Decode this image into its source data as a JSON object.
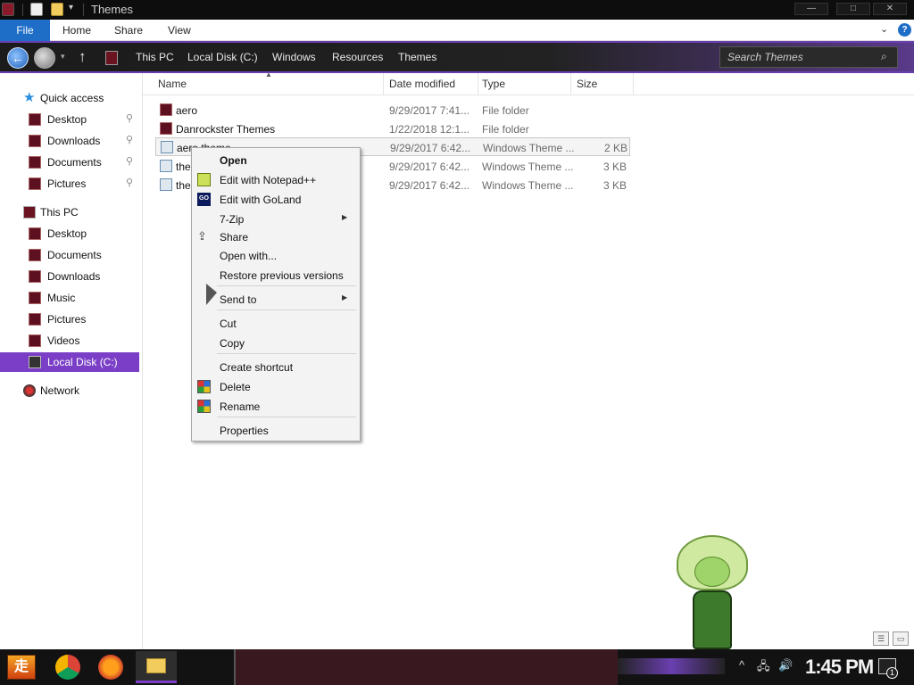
{
  "window": {
    "title": "Themes",
    "minimize_glyph": "—",
    "maximize_glyph": "□",
    "close_glyph": "✕"
  },
  "ribbon": {
    "tabs": [
      "File",
      "Home",
      "Share",
      "View"
    ],
    "help_glyph": "?",
    "expand_glyph": "⌄"
  },
  "address": {
    "back_glyph": "←",
    "up_glyph": "↑",
    "breadcrumbs": [
      "This PC",
      "Local Disk (C:)",
      "Windows",
      "Resources",
      "Themes"
    ],
    "search_placeholder": "Search Themes"
  },
  "sidebar": {
    "quick_access": "Quick access",
    "quick_items": [
      {
        "label": "Desktop",
        "icon": "folder-icon"
      },
      {
        "label": "Downloads",
        "icon": "folder-icon"
      },
      {
        "label": "Documents",
        "icon": "folder-icon"
      },
      {
        "label": "Pictures",
        "icon": "folder-icon"
      }
    ],
    "this_pc": "This PC",
    "pc_items": [
      {
        "label": "Desktop",
        "icon": "folder-icon"
      },
      {
        "label": "Documents",
        "icon": "folder-icon"
      },
      {
        "label": "Downloads",
        "icon": "folder-icon"
      },
      {
        "label": "Music",
        "icon": "folder-icon"
      },
      {
        "label": "Pictures",
        "icon": "folder-icon"
      },
      {
        "label": "Videos",
        "icon": "folder-icon"
      }
    ],
    "selected_drive": "Local Disk (C:)",
    "network": "Network",
    "pin_glyph": "📌"
  },
  "columns": [
    "Name",
    "Date modified",
    "Type",
    "Size"
  ],
  "files": [
    {
      "name": "aero",
      "date": "9/29/2017 7:41...",
      "type": "File folder",
      "size": "",
      "icon": "folder"
    },
    {
      "name": "Danrockster Themes",
      "date": "1/22/2018 12:1...",
      "type": "File folder",
      "size": "",
      "icon": "folder"
    },
    {
      "name": "aero.theme",
      "date": "9/29/2017 6:42...",
      "type": "Windows Theme ...",
      "size": "2 KB",
      "icon": "theme",
      "selected": true
    },
    {
      "name": "the",
      "date": "9/29/2017 6:42...",
      "type": "Windows Theme ...",
      "size": "3 KB",
      "icon": "theme"
    },
    {
      "name": "the",
      "date": "9/29/2017 6:42...",
      "type": "Windows Theme ...",
      "size": "3 KB",
      "icon": "theme"
    }
  ],
  "context_menu": {
    "items": [
      {
        "label": "Open",
        "bold": true
      },
      {
        "label": "Edit with Notepad++",
        "icon": "notepad-plus-plus-icon"
      },
      {
        "label": "Edit with GoLand",
        "icon": "goland-icon",
        "icon_text": "GO"
      },
      {
        "label": "7-Zip",
        "submenu": true
      },
      {
        "label": "Share",
        "icon": "share-icon"
      },
      {
        "label": "Open with..."
      },
      {
        "label": "Restore previous versions"
      },
      {
        "label": "Send to",
        "submenu": true
      },
      {
        "label": "Cut"
      },
      {
        "label": "Copy"
      },
      {
        "label": "Create shortcut"
      },
      {
        "label": "Delete",
        "icon": "shield-icon"
      },
      {
        "label": "Rename",
        "icon": "shield-icon"
      },
      {
        "label": "Properties"
      }
    ],
    "submenu_glyph": "▶"
  },
  "taskbar": {
    "start_glyph": "走",
    "clock": "1:45 PM",
    "notification_count": "1",
    "tray_icons": [
      "network-icon",
      "volume-icon"
    ]
  },
  "colors": {
    "accent_purple": "#7a3fc6",
    "file_tab_blue": "#1e6ec8",
    "taskbar_dark": "#121212"
  }
}
